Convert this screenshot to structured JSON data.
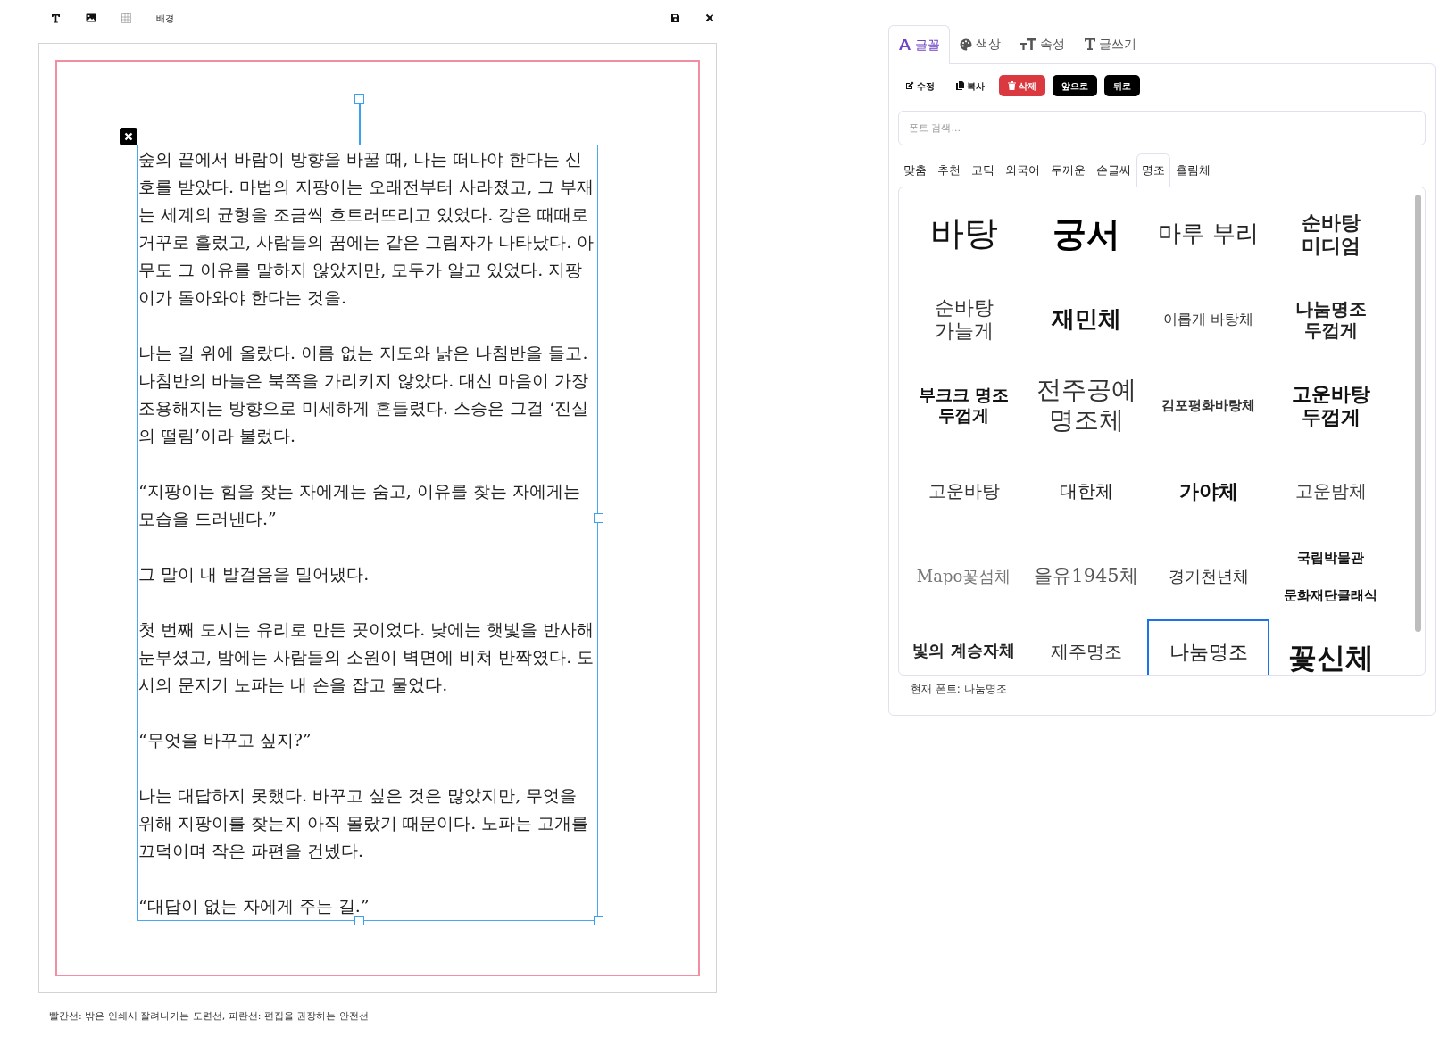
{
  "toolbar": {
    "background_label": "배경"
  },
  "story": {
    "paragraphs": [
      "숲의 끝에서 바람이 방향을 바꿀 때, 나는 떠나야 한다는 신호를 받았다. 마법의 지팡이는 오래전부터 사라졌고, 그 부재는 세계의 균형을 조금씩 흐트러뜨리고 있었다. 강은 때때로 거꾸로 흘렀고, 사람들의 꿈에는 같은 그림자가 나타났다. 아무도 그 이유를 말하지 않았지만, 모두가 알고 있었다. 지팡이가 돌아와야 한다는 것을.",
      "나는 길 위에 올랐다. 이름 없는 지도와 낡은 나침반을 들고. 나침반의 바늘은 북쪽을 가리키지 않았다. 대신 마음이 가장 조용해지는 방향으로 미세하게 흔들렸다. 스승은 그걸 ‘진실의 떨림’이라 불렀다.",
      "“지팡이는 힘을 찾는 자에게는 숨고, 이유를 찾는 자에게는 모습을 드러낸다.”",
      "그 말이 내 발걸음을 밀어냈다.",
      "첫 번째 도시는 유리로 만든 곳이었다. 낮에는 햇빛을 반사해 눈부셨고, 밤에는 사람들의 소원이 벽면에 비쳐 반짝였다. 도시의 문지기 노파는 내 손을 잡고 물었다.",
      "“무엇을 바꾸고 싶지?”",
      "나는 대답하지 못했다. 바꾸고 싶은 것은 많았지만, 무엇을 위해 지팡이를 찾는지 아직 몰랐기 때문이다. 노파는 고개를 끄덕이며 작은 파편을 건넸다.",
      "“대답이 없는 자에게 주는 길.”"
    ]
  },
  "caption": "빨간선: 밖은 인쇄시 잘려나가는 도련선, 파란선: 편집을 권장하는 안전선",
  "panel": {
    "tabs": [
      {
        "label": "글꼴",
        "selected": true
      },
      {
        "label": "색상",
        "selected": false
      },
      {
        "label": "속성",
        "selected": false
      },
      {
        "label": "글쓰기",
        "selected": false
      }
    ],
    "buttons": [
      {
        "label": "수정",
        "kind": "plain"
      },
      {
        "label": "복사",
        "kind": "plain"
      },
      {
        "label": "삭제",
        "kind": "danger"
      },
      {
        "label": "앞으로",
        "kind": "dark"
      },
      {
        "label": "뒤로",
        "kind": "dark"
      }
    ],
    "search": {
      "placeholder": "폰트 검색..."
    },
    "categories": [
      {
        "label": "맞춤",
        "selected": false
      },
      {
        "label": "추천",
        "selected": false
      },
      {
        "label": "고딕",
        "selected": false
      },
      {
        "label": "외국어",
        "selected": false
      },
      {
        "label": "두꺼운",
        "selected": false
      },
      {
        "label": "손글씨",
        "selected": false
      },
      {
        "label": "명조",
        "selected": true
      },
      {
        "label": "흘림체",
        "selected": false
      }
    ],
    "fonts": [
      {
        "label": "바탕",
        "selected": false
      },
      {
        "label": "궁서",
        "selected": false
      },
      {
        "label": "마루 부리",
        "selected": false
      },
      {
        "label": "순바탕 미디엄",
        "selected": false
      },
      {
        "label": "순바탕 가늘게",
        "selected": false
      },
      {
        "label": "재민체",
        "selected": false
      },
      {
        "label": "이롭게 바탕체",
        "selected": false
      },
      {
        "label": "나눔명조 두껍게",
        "selected": false
      },
      {
        "label": "부크크 명조 두껍게",
        "selected": false
      },
      {
        "label": "전주공예 명조체",
        "selected": false
      },
      {
        "label": "김포평화바탕체",
        "selected": false
      },
      {
        "label": "고운바탕 두껍게",
        "selected": false
      },
      {
        "label": "고운바탕",
        "selected": false
      },
      {
        "label": "대한체",
        "selected": false
      },
      {
        "label": "가야체",
        "selected": false
      },
      {
        "label": "고운밤체",
        "selected": false
      },
      {
        "label": "Mapo꽃섬체",
        "selected": false
      },
      {
        "label": "을유1945체",
        "selected": false
      },
      {
        "label": "경기천년체",
        "selected": false
      },
      {
        "label": "국립박물관 문화재단클래식",
        "selected": false
      },
      {
        "label": "빛의 계승자체",
        "selected": false
      },
      {
        "label": "제주명조",
        "selected": false
      },
      {
        "label": "나눔명조",
        "selected": true
      },
      {
        "label": "꽃신체",
        "selected": false
      }
    ],
    "current_font": "현재 폰트: 나눔명조"
  }
}
